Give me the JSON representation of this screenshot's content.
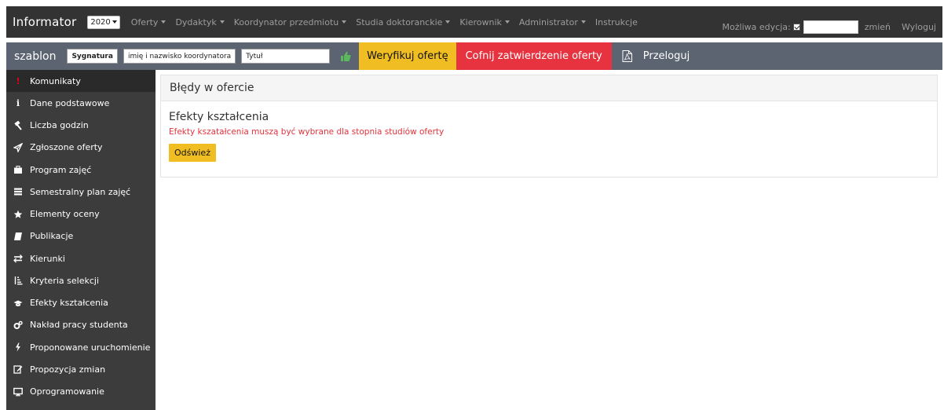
{
  "topbar": {
    "brand": "Informator",
    "year": "2020",
    "menu": [
      {
        "label": "Oferty",
        "dropdown": true
      },
      {
        "label": "Dydaktyk",
        "dropdown": true
      },
      {
        "label": "Koordynator przedmiotu",
        "dropdown": true
      },
      {
        "label": "Studia doktoranckie",
        "dropdown": true
      },
      {
        "label": "Kierownik",
        "dropdown": true
      },
      {
        "label": "Administrator",
        "dropdown": true
      },
      {
        "label": "Instrukcje",
        "dropdown": false
      }
    ],
    "edit_label": "Możliwa edycja:",
    "edit_input_value": "",
    "change_link": "zmień",
    "logout_link": "Wyloguj"
  },
  "toolbar": {
    "label": "szablon",
    "signature_value": "Sygnatura",
    "coordinator_value": "imię i nazwisko koordynatora",
    "title_value": "Tytuł",
    "verify_button": "Weryfikuj ofertę",
    "revoke_button": "Cofnij zatwierdzenie oferty",
    "relogin_link": "Przeloguj"
  },
  "sidebar": {
    "items": [
      {
        "label": "Komunikaty",
        "icon": "exclamation-icon",
        "active": true
      },
      {
        "label": "Dane podstawowe",
        "icon": "info-icon",
        "active": false
      },
      {
        "label": "Liczba godzin",
        "icon": "gavel-icon",
        "active": false
      },
      {
        "label": "Zgłoszone oferty",
        "icon": "send-icon",
        "active": false
      },
      {
        "label": "Program zajęć",
        "icon": "briefcase-icon",
        "active": false
      },
      {
        "label": "Semestralny plan zajęć",
        "icon": "list-icon",
        "active": false
      },
      {
        "label": "Elementy oceny",
        "icon": "star-icon",
        "active": false
      },
      {
        "label": "Publikacje",
        "icon": "book-icon",
        "active": false
      },
      {
        "label": "Kierunki",
        "icon": "exchange-icon",
        "active": false
      },
      {
        "label": "Kryteria selekcji",
        "icon": "sort-icon",
        "active": false
      },
      {
        "label": "Efekty kształcenia",
        "icon": "graduation-cap-icon",
        "active": false
      },
      {
        "label": "Nakład pracy studenta",
        "icon": "cogs-icon",
        "active": false
      },
      {
        "label": "Proponowane uruchomienie",
        "icon": "bolt-icon",
        "active": false
      },
      {
        "label": "Propozycja zmian",
        "icon": "edit-icon",
        "active": false
      },
      {
        "label": "Oprogramowanie",
        "icon": "desktop-icon",
        "active": false
      }
    ]
  },
  "main": {
    "panel_title": "Błędy w ofercie",
    "section_title": "Efekty kształcenia",
    "error_message": "Efekty kszatałcenia muszą być wybrane dla stopnia studiów oferty",
    "refresh_button": "Odśwież"
  },
  "colors": {
    "navbar": "#333333",
    "toolbar": "#5b6470",
    "sidebar": "#3c3c3c",
    "accent_yellow": "#f0bd22",
    "accent_red": "#e7333f",
    "error_text": "#e2333c",
    "thumb_green": "#5cb85c"
  }
}
